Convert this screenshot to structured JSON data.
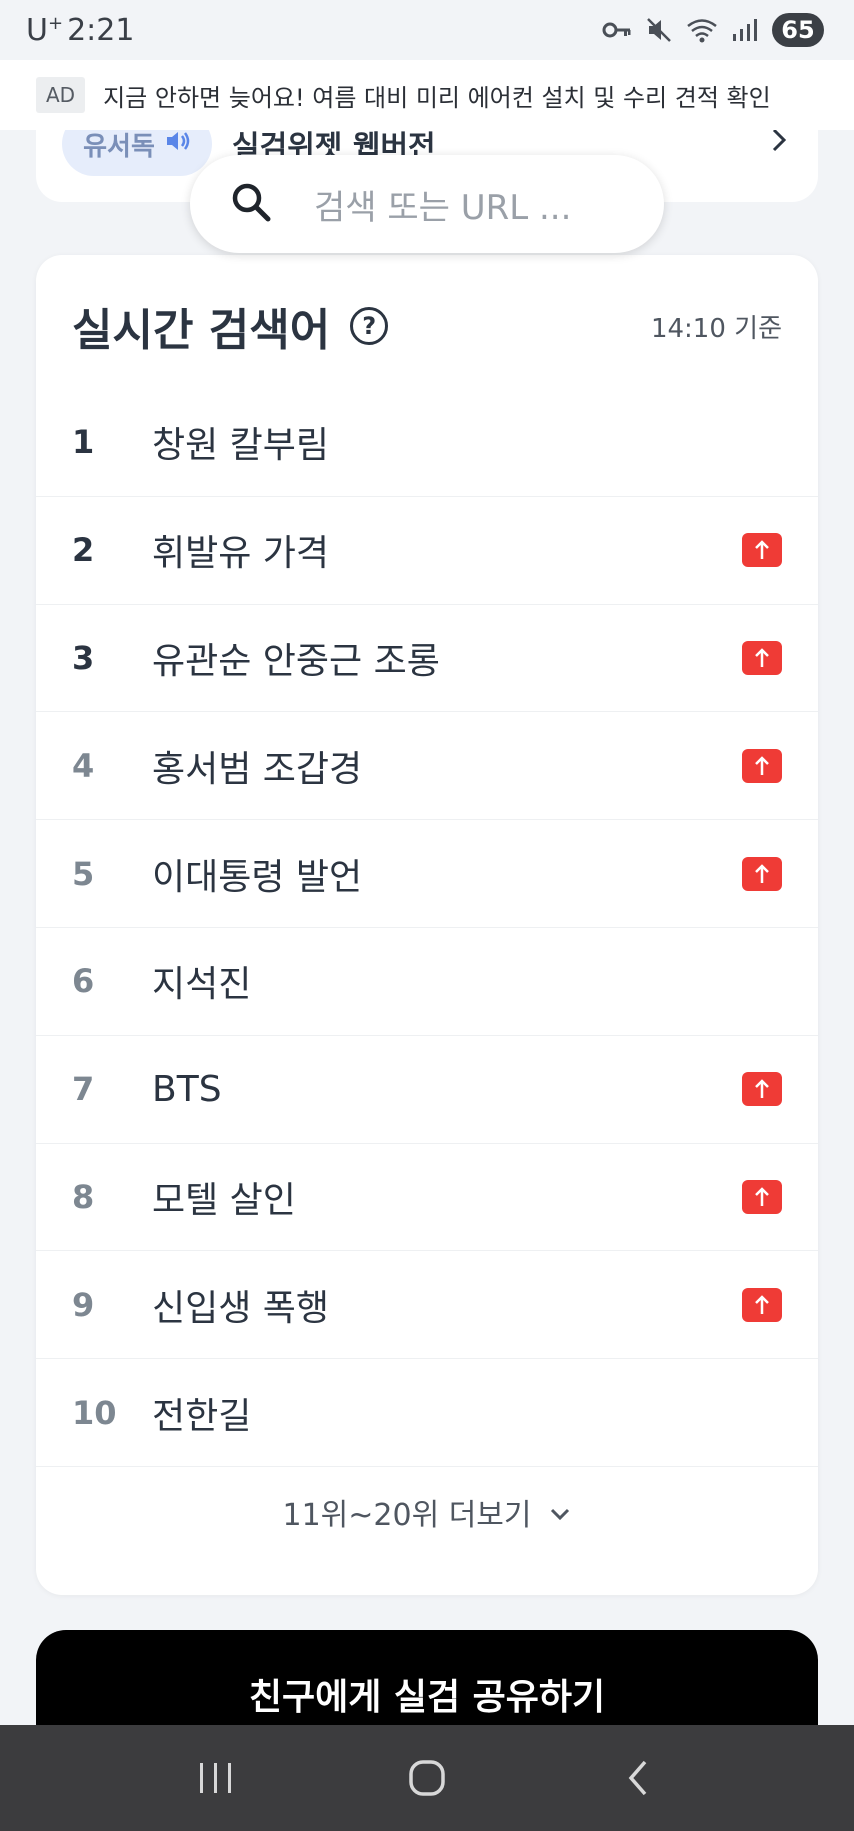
{
  "status_bar": {
    "carrier": "U",
    "carrier_sup": "+",
    "time": "2:21",
    "battery": "65"
  },
  "ad": {
    "badge": "AD",
    "text": "지금 안하면 늦어요! 여름 대비 미리 에어컨 설치 및 수리 견적 확인"
  },
  "top_widget": {
    "pill_label": "유서독",
    "title": "실검위젯 웹버전"
  },
  "search": {
    "placeholder": "검색 또는 URL ..."
  },
  "realtime": {
    "title": "실시간 검색어",
    "time_label": "14:10 기준",
    "items": [
      {
        "rank": "1",
        "keyword": "창원 칼부림",
        "trend": "none"
      },
      {
        "rank": "2",
        "keyword": "휘발유 가격",
        "trend": "up"
      },
      {
        "rank": "3",
        "keyword": "유관순 안중근 조롱",
        "trend": "up"
      },
      {
        "rank": "4",
        "keyword": "홍서범 조갑경",
        "trend": "up"
      },
      {
        "rank": "5",
        "keyword": "이대통령 발언",
        "trend": "up"
      },
      {
        "rank": "6",
        "keyword": "지석진",
        "trend": "none"
      },
      {
        "rank": "7",
        "keyword": "BTS",
        "trend": "up"
      },
      {
        "rank": "8",
        "keyword": "모텔 살인",
        "trend": "up"
      },
      {
        "rank": "9",
        "keyword": "신입생 폭행",
        "trend": "up"
      },
      {
        "rank": "10",
        "keyword": "전한길",
        "trend": "none"
      }
    ],
    "more_label": "11위~20위 더보기"
  },
  "share_button": {
    "label": "친구에게 실검 공유하기"
  },
  "colors": {
    "up_badge": "#ef3b36",
    "background": "#f2f4f7",
    "share_button": "#000000",
    "nav_bar": "#3c3c3e"
  },
  "icons": {
    "search": "search-icon",
    "help": "help-icon",
    "up": "arrow-up-icon",
    "more": "chevron-down-icon",
    "nav": [
      "recent-apps-icon",
      "home-icon",
      "back-icon"
    ]
  }
}
